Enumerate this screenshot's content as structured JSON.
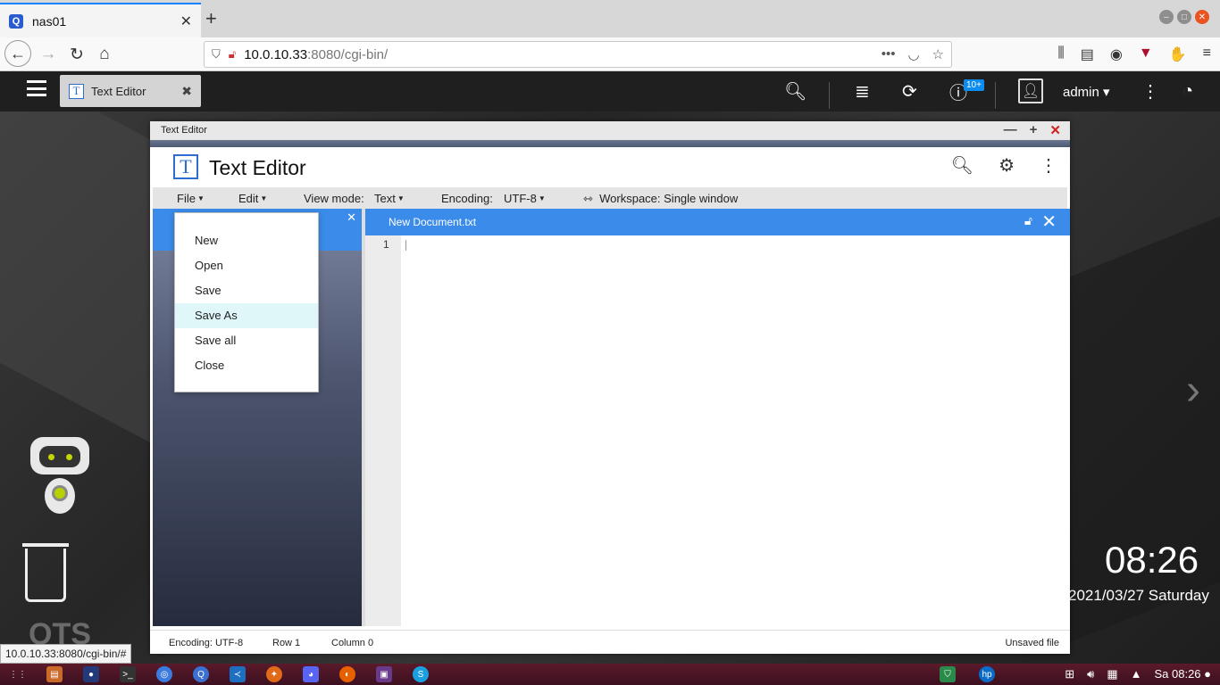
{
  "browser": {
    "tab_title": "nas01",
    "tab_close": "✕",
    "new_tab": "+",
    "url_host": "10.0.10.33",
    "url_rest": ":8080/cgi-bin/",
    "url_more": "•••",
    "status_url": "10.0.10.33:8080/cgi-bin/#"
  },
  "qts": {
    "app_tab_label": "Text Editor",
    "app_tab_close": "✖",
    "notification_badge": "10+",
    "user": "admin ▾",
    "clock": "08:26",
    "date": "2021/03/27 Saturday",
    "logo": "QTS"
  },
  "window": {
    "title": "Text Editor",
    "app_title": "Text Editor"
  },
  "menubar": {
    "file": "File",
    "edit": "Edit",
    "view_mode_label": "View mode:",
    "view_mode_value": "Text",
    "encoding_label": "Encoding:",
    "encoding_value": "UTF-8",
    "workspace": "Workspace: Single window"
  },
  "file_menu": {
    "items": [
      "New",
      "Open",
      "Save",
      "Save As",
      "Save all",
      "Close"
    ],
    "hovered": "Save As"
  },
  "document": {
    "tab_name": "New Document.txt",
    "line_number": "1"
  },
  "statusbar": {
    "encoding": "Encoding: UTF-8",
    "row": "Row 1",
    "column": "Column 0",
    "state": "Unsaved file"
  },
  "taskbar": {
    "clock": "Sa 08:26 ●"
  },
  "colors": {
    "accent_blue": "#3a8bea",
    "menu_hover": "#e0f7fa",
    "close_red": "#d02020"
  }
}
